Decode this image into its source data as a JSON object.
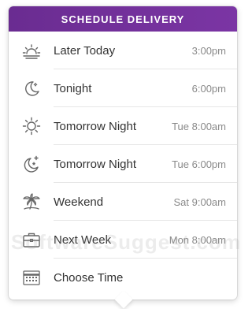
{
  "header": {
    "title": "SCHEDULE DELIVERY"
  },
  "colors": {
    "header_start": "#6a2c91",
    "header_end": "#7b35a4",
    "icon": "#666666"
  },
  "items": [
    {
      "label": "Later Today",
      "time": "3:00pm",
      "icon": "sunset-icon"
    },
    {
      "label": "Tonight",
      "time": "6:00pm",
      "icon": "moon-icon"
    },
    {
      "label": "Tomorrow Night",
      "time": "Tue 8:00am",
      "icon": "sun-icon"
    },
    {
      "label": "Tomorrow Night",
      "time": "Tue 6:00pm",
      "icon": "moon-star-icon"
    },
    {
      "label": "Weekend",
      "time": "Sat 9:00am",
      "icon": "palm-tree-icon"
    },
    {
      "label": "Next Week",
      "time": "Mon 8:00am",
      "icon": "briefcase-icon"
    },
    {
      "label": "Choose Time",
      "time": "",
      "icon": "calendar-icon"
    }
  ],
  "watermark": "SoftwareSuggest.com"
}
